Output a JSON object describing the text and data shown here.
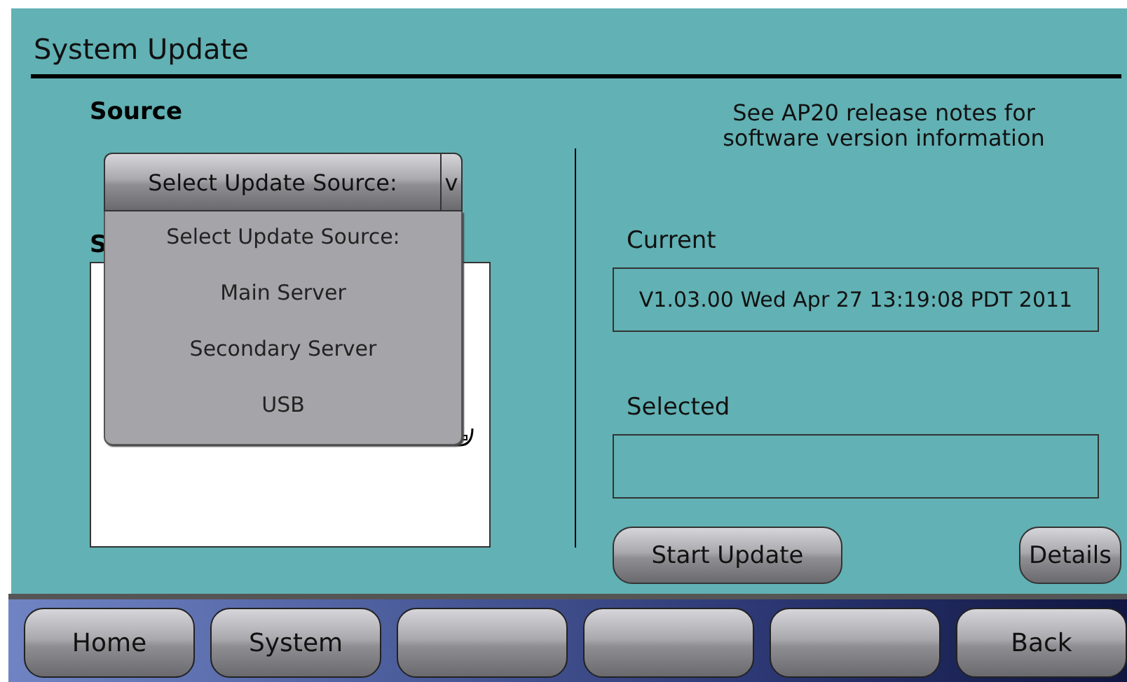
{
  "window": {
    "title": "System Update"
  },
  "source": {
    "label": "Source",
    "dropdown": {
      "value": "Select Update Source:",
      "arrow": "v",
      "expanded": true,
      "options": [
        "Select Update Source:",
        "Main Server",
        "Secondary Server",
        "USB"
      ]
    },
    "hidden_label": "S"
  },
  "info": {
    "note": "See AP20 release notes for software version information",
    "current": {
      "label": "Current",
      "value": "V1.03.00 Wed Apr 27 13:19:08 PDT 2011"
    },
    "selected": {
      "label": "Selected"
    }
  },
  "actions": [
    "Start Update",
    "Details"
  ],
  "nav_buttons": [
    {
      "kind": "labeled",
      "label": "Home"
    },
    {
      "kind": "labeled",
      "label": "System"
    },
    {
      "kind": "blank"
    },
    {
      "kind": "blank"
    },
    {
      "kind": "blank"
    },
    {
      "kind": "labeled",
      "label": "Back"
    }
  ]
}
